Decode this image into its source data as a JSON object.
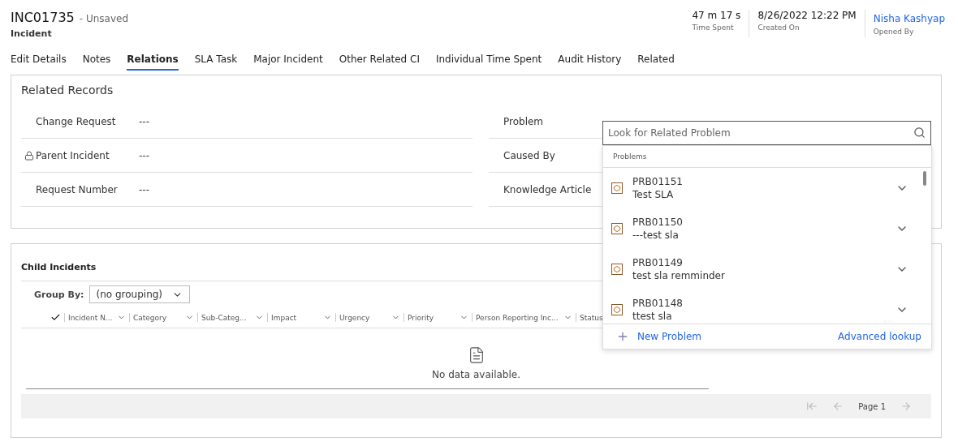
{
  "record": {
    "title": "INC01735",
    "status": "- Unsaved",
    "entity": "Incident"
  },
  "header_fields": [
    {
      "value": "47 m 17 s",
      "label": "Time Spent",
      "kind": "text"
    },
    {
      "value": "8/26/2022 12:22 PM",
      "label": "Created On",
      "kind": "text"
    },
    {
      "value": "Nisha Kashyap",
      "label": "Opened By",
      "kind": "link"
    }
  ],
  "tabs": [
    {
      "label": "Edit Details",
      "selected": false
    },
    {
      "label": "Notes",
      "selected": false
    },
    {
      "label": "Relations",
      "selected": true
    },
    {
      "label": "SLA Task",
      "selected": false
    },
    {
      "label": "Major Incident",
      "selected": false
    },
    {
      "label": "Other Related CI",
      "selected": false
    },
    {
      "label": "Individual Time Spent",
      "selected": false
    },
    {
      "label": "Audit History",
      "selected": false
    },
    {
      "label": "Related",
      "selected": false
    }
  ],
  "related_records": {
    "title": "Related Records",
    "left_fields": [
      {
        "label": "Change Request",
        "value": "---",
        "locked": false
      },
      {
        "label": "Parent Incident",
        "value": "---",
        "locked": true
      },
      {
        "label": "Request Number",
        "value": "---",
        "locked": false
      }
    ],
    "right_fields": [
      {
        "label": "Problem"
      },
      {
        "label": "Caused By"
      },
      {
        "label": "Knowledge Article"
      }
    ],
    "lookup": {
      "placeholder": "Look for Related Problem",
      "group_label": "Problems",
      "results": [
        {
          "id": "PRB01151",
          "name": "Test SLA"
        },
        {
          "id": "PRB01150",
          "name": "---test sla"
        },
        {
          "id": "PRB01149",
          "name": "test sla remminder"
        },
        {
          "id": "PRB01148",
          "name": "ttest sla"
        }
      ],
      "new_label": "New Problem",
      "advanced_label": "Advanced lookup"
    }
  },
  "child_incidents": {
    "title": "Child Incidents",
    "group_by_label": "Group By:",
    "group_by_value": "(no grouping)",
    "columns": [
      "Incident N...",
      "Category",
      "Sub-Categ...",
      "Impact",
      "Urgency",
      "Priority",
      "Person Reporting Inc...",
      "Status"
    ],
    "empty_text": "No data available.",
    "page_label": "Page 1"
  }
}
